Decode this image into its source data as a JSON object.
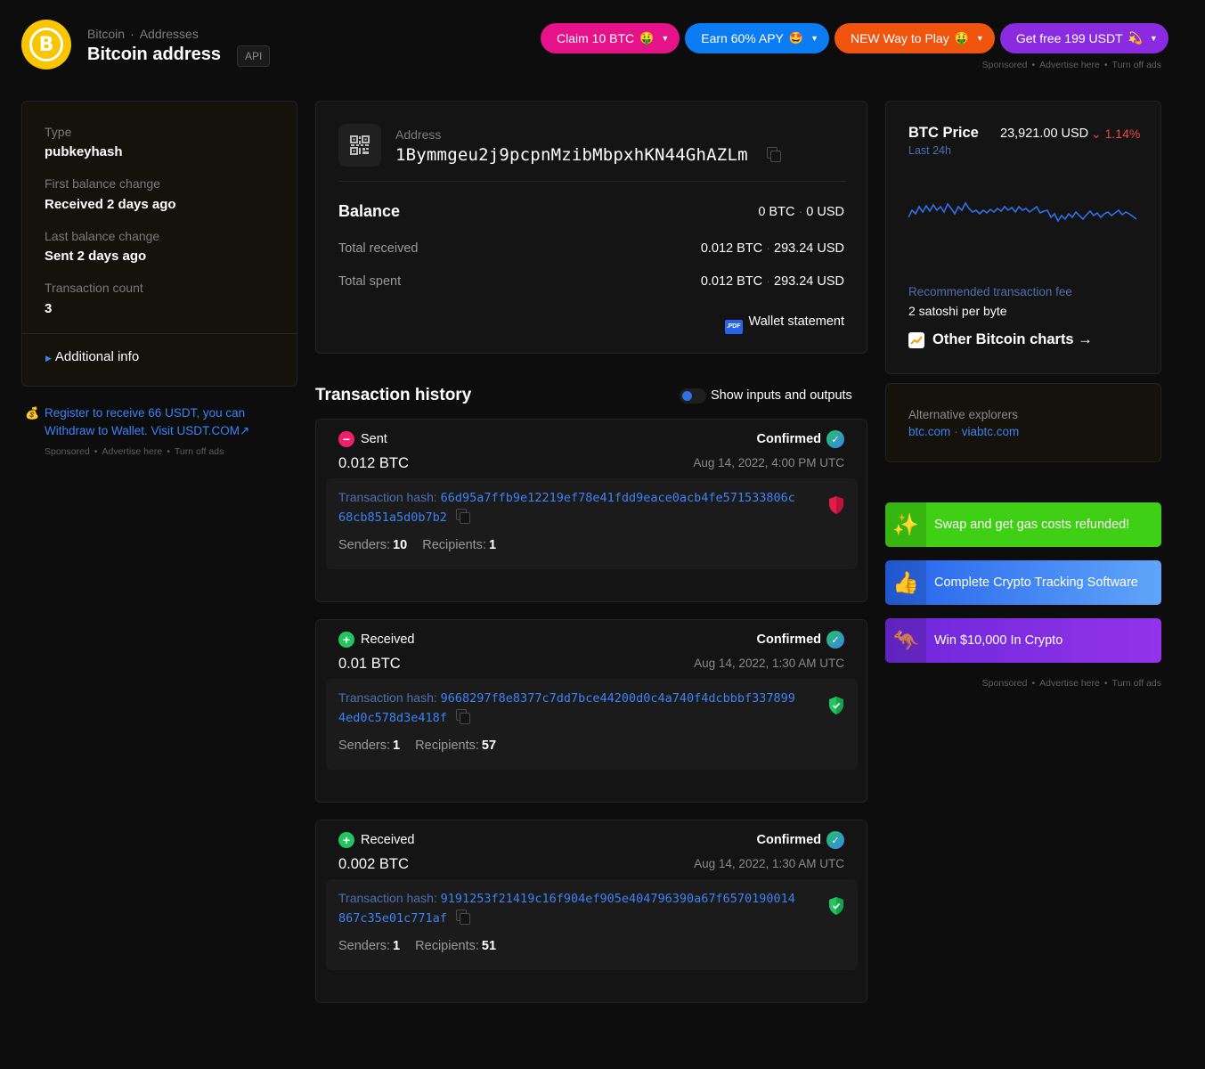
{
  "header": {
    "breadcrumb": [
      "Bitcoin",
      "Addresses"
    ],
    "title": "Bitcoin address",
    "api_label": "API",
    "logo_glyph": "B"
  },
  "top_ads": {
    "pills": [
      {
        "label": "Claim 10 BTC",
        "emoji": "🤑",
        "color": "#e6128a"
      },
      {
        "label": "Earn 60% APY",
        "emoji": "🤩",
        "color": "#0b7cf2"
      },
      {
        "label": "NEW Way to Play",
        "emoji": "🤑",
        "color": "#f0550f"
      },
      {
        "label": "Get free 199 USDT",
        "emoji": "💫",
        "color": "#8a2be2"
      }
    ],
    "sponsored": "Sponsored",
    "advertise": "Advertise here",
    "turn_off": "Turn off ads"
  },
  "info": {
    "type_label": "Type",
    "type_value": "pubkeyhash",
    "first_label": "First balance change",
    "first_value": "Received 2 days ago",
    "last_label": "Last balance change",
    "last_value": "Sent 2 days ago",
    "count_label": "Transaction count",
    "count_value": "3",
    "additional_info": "Additional info"
  },
  "left_promo": {
    "emoji": "💰",
    "text": "Register to receive 66 USDT, you can Withdraw to Wallet. Visit USDT.COM↗"
  },
  "address": {
    "label": "Address",
    "value": "1Bymmgeu2j9pcpnMzibMbpxhKN44GhAZLm"
  },
  "balance": {
    "title": "Balance",
    "btc": "0 BTC",
    "usd": "0 USD",
    "total_received_label": "Total received",
    "total_received_btc": "0.012 BTC",
    "total_received_usd": "293.24 USD",
    "total_spent_label": "Total spent",
    "total_spent_btc": "0.012 BTC",
    "total_spent_usd": "293.24 USD",
    "statement": "Wallet statement",
    "pdf_badge": ".PDF"
  },
  "history": {
    "title": "Transaction history",
    "toggle_label": "Show inputs and outputs",
    "hash_label": "Transaction hash:",
    "senders_label": "Senders:",
    "recipients_label": "Recipients:",
    "items": [
      {
        "direction": "Sent",
        "amount": "0.012 BTC",
        "status": "Confirmed",
        "date": "Aug 14, 2022, 4:00 PM UTC",
        "hash_line1": "66d95a7ffb9e12219ef78e41fdd9eace0acb4fe571533806c",
        "hash_line2": "68cb851a5d0b7b2",
        "senders": "10",
        "recipients": "1"
      },
      {
        "direction": "Received",
        "amount": "0.01 BTC",
        "status": "Confirmed",
        "date": "Aug 14, 2022, 1:30 AM UTC",
        "hash_line1": "9668297f8e8377c7dd7bce44200d0c4a740f4dcbbbf337899",
        "hash_line2": "4ed0c578d3e418f",
        "senders": "1",
        "recipients": "57"
      },
      {
        "direction": "Received",
        "amount": "0.002 BTC",
        "status": "Confirmed",
        "date": "Aug 14, 2022, 1:30 AM UTC",
        "hash_line1": "9191253f21419c16f904ef905e404796390a67f6570190014",
        "hash_line2": "867c35e01c771af",
        "senders": "1",
        "recipients": "51"
      }
    ]
  },
  "price": {
    "title": "BTC Price",
    "subtitle": "Last 24h",
    "usd": "23,921.00 USD",
    "change": "1.14%",
    "change_arrow": "⌄",
    "fee_label": "Recommended transaction fee",
    "fee_value": "2 satoshi per byte",
    "charts_link": "Other Bitcoin charts →"
  },
  "alternatives": {
    "label": "Alternative explorers",
    "links": [
      "btc.com",
      "viabtc.com"
    ]
  },
  "side_ads": [
    {
      "emoji": "✨",
      "label": "Swap and get gas costs refunded!",
      "bg": "#3fcf14"
    },
    {
      "emoji": "👍",
      "label": "Complete Crypto Tracking Software",
      "bg": "#3b82f6"
    },
    {
      "emoji": "🦘",
      "label": "Win $10,000 In Crypto",
      "bg": "#6d28d9"
    }
  ],
  "colors": {
    "accent": "#3b82f6",
    "sent": "#ef1f6b",
    "received": "#22c55e",
    "negative": "#ef4444"
  }
}
